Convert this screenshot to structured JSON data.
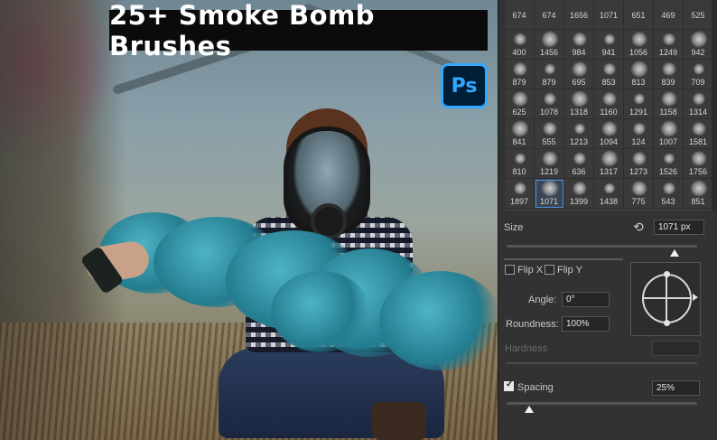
{
  "banner": {
    "title": "25+ Smoke Bomb Brushes",
    "app_logo_text": "Ps"
  },
  "colors": {
    "panel_bg": "#323232",
    "selection_accent": "#4d8ed8",
    "ps_blue": "#31a8ff",
    "ps_dark": "#001e36"
  },
  "brush_panel": {
    "brush_sizes": [
      "674",
      "674",
      "1656",
      "1071",
      "651",
      "469",
      "525",
      "400",
      "1456",
      "984",
      "941",
      "1056",
      "1249",
      "942",
      "879",
      "879",
      "695",
      "853",
      "813",
      "839",
      "709",
      "625",
      "1078",
      "1318",
      "1160",
      "1291",
      "1158",
      "1314",
      "841",
      "555",
      "1213",
      "1094",
      "124",
      "1007",
      "1581",
      "810",
      "1219",
      "636",
      "1317",
      "1273",
      "1526",
      "1756",
      "1897",
      "1071",
      "1399",
      "1438",
      "775",
      "543",
      "851"
    ],
    "selected_index": 43,
    "size": {
      "label": "Size",
      "value": "1071 px",
      "slider_fraction": 0.88
    },
    "flip_x": {
      "label": "Flip X",
      "checked": false
    },
    "flip_y": {
      "label": "Flip Y",
      "checked": false
    },
    "angle": {
      "label": "Angle:",
      "value": "0°"
    },
    "roundness": {
      "label": "Roundness:",
      "value": "100%"
    },
    "hardness": {
      "label": "Hardness",
      "value": ""
    },
    "spacing": {
      "label": "Spacing",
      "value": "25%",
      "checked": true,
      "slider_fraction": 0.12
    }
  }
}
